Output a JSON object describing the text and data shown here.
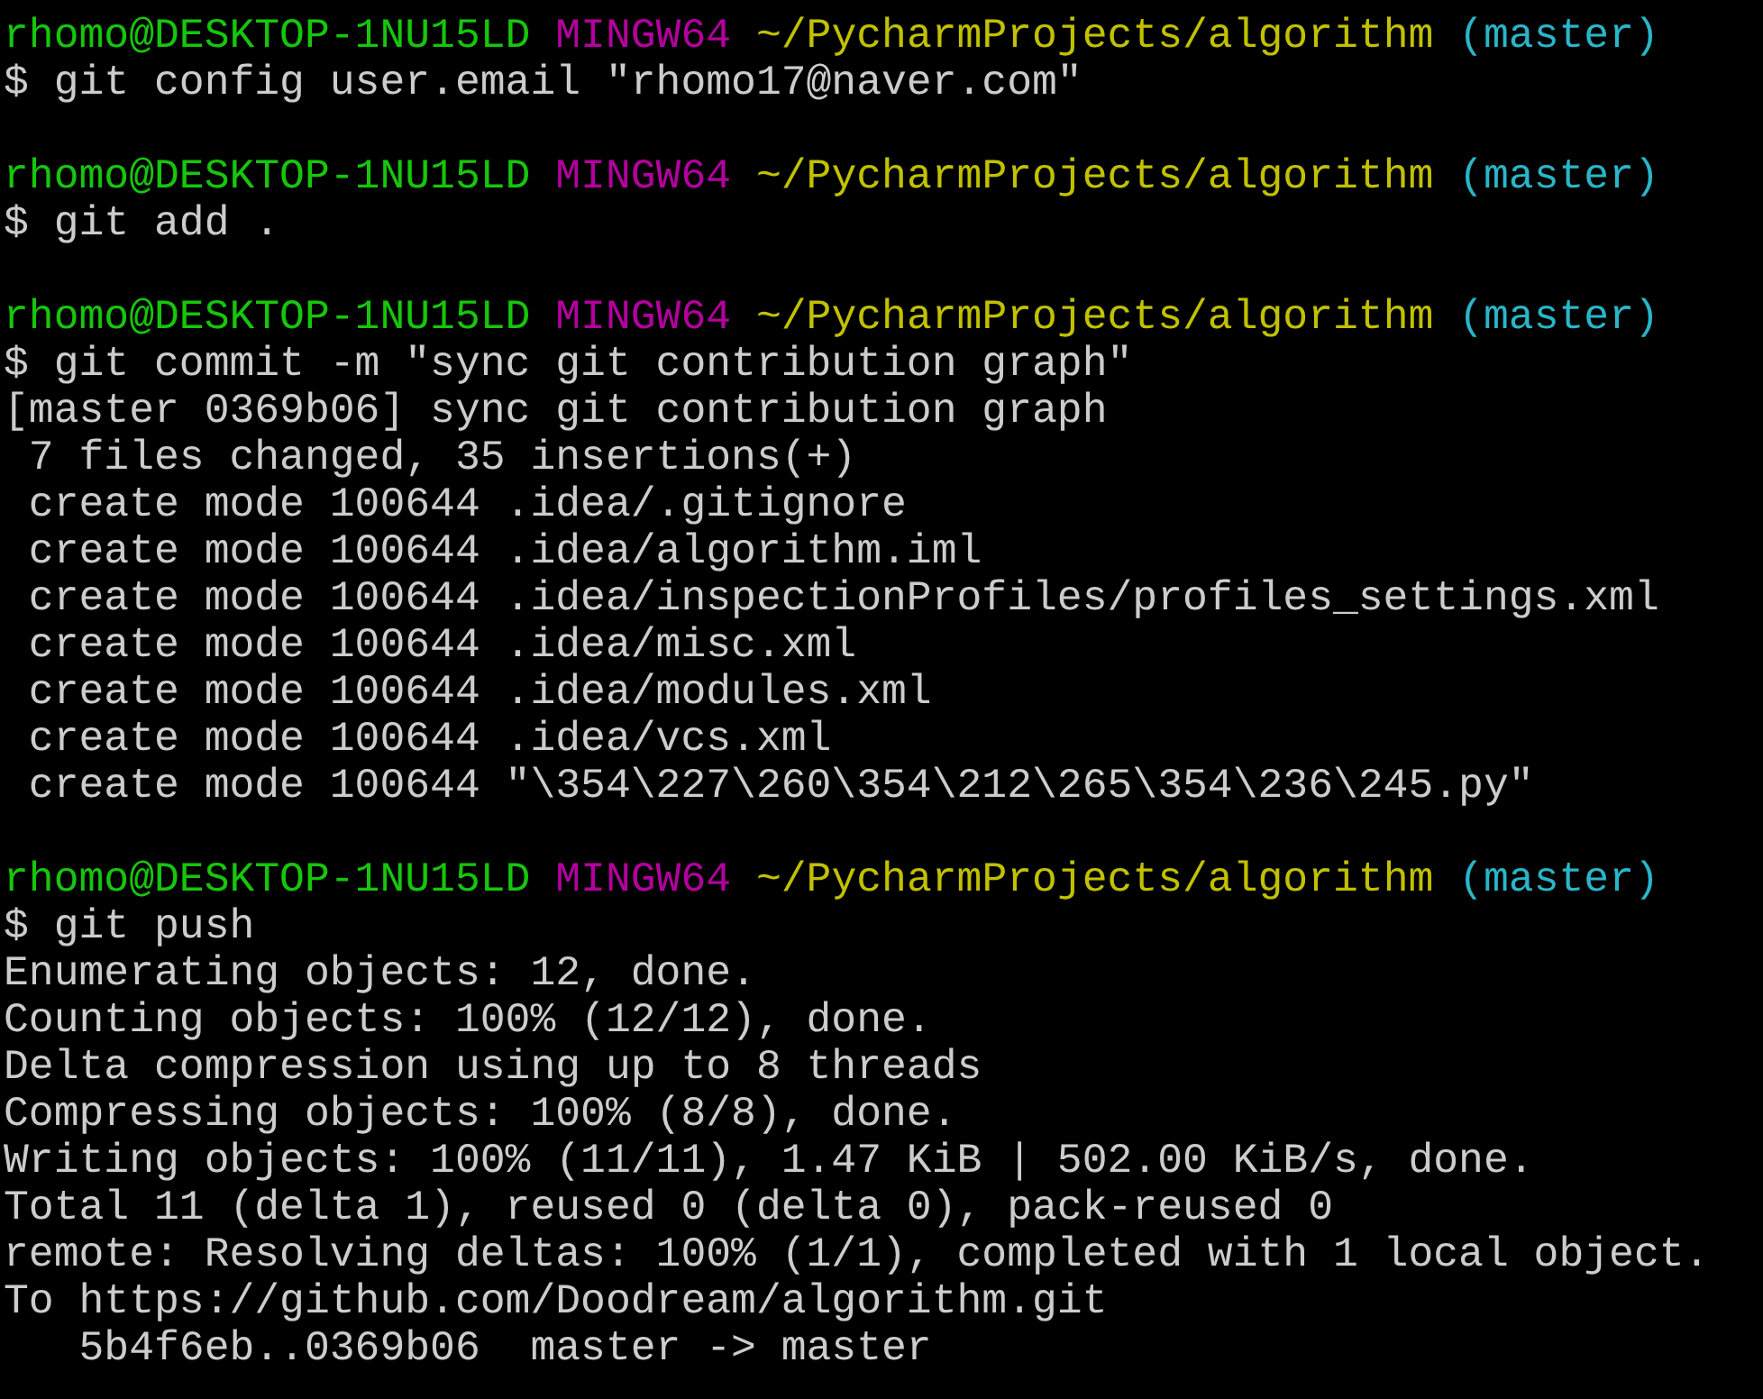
{
  "terminal": {
    "lines": [
      {
        "kind": "prompt",
        "user_host": "rhomo@DESKTOP-1NU15LD",
        "shell": "MINGW64",
        "path": "~/PycharmProjects/algorithm",
        "branch": "(master)"
      },
      {
        "kind": "command",
        "text": "$ git config user.email \"rhomo17@naver.com\""
      },
      {
        "kind": "blank"
      },
      {
        "kind": "prompt",
        "user_host": "rhomo@DESKTOP-1NU15LD",
        "shell": "MINGW64",
        "path": "~/PycharmProjects/algorithm",
        "branch": "(master)"
      },
      {
        "kind": "command",
        "text": "$ git add ."
      },
      {
        "kind": "blank"
      },
      {
        "kind": "prompt",
        "user_host": "rhomo@DESKTOP-1NU15LD",
        "shell": "MINGW64",
        "path": "~/PycharmProjects/algorithm",
        "branch": "(master)"
      },
      {
        "kind": "command",
        "text": "$ git commit -m \"sync git contribution graph\""
      },
      {
        "kind": "output",
        "text": "[master 0369b06] sync git contribution graph"
      },
      {
        "kind": "output",
        "text": " 7 files changed, 35 insertions(+)"
      },
      {
        "kind": "output",
        "text": " create mode 100644 .idea/.gitignore"
      },
      {
        "kind": "output",
        "text": " create mode 100644 .idea/algorithm.iml"
      },
      {
        "kind": "output",
        "text": " create mode 100644 .idea/inspectionProfiles/profiles_settings.xml"
      },
      {
        "kind": "output",
        "text": " create mode 100644 .idea/misc.xml"
      },
      {
        "kind": "output",
        "text": " create mode 100644 .idea/modules.xml"
      },
      {
        "kind": "output",
        "text": " create mode 100644 .idea/vcs.xml"
      },
      {
        "kind": "output",
        "text": " create mode 100644 \"\\354\\227\\260\\354\\212\\265\\354\\236\\245.py\""
      },
      {
        "kind": "blank"
      },
      {
        "kind": "prompt",
        "user_host": "rhomo@DESKTOP-1NU15LD",
        "shell": "MINGW64",
        "path": "~/PycharmProjects/algorithm",
        "branch": "(master)"
      },
      {
        "kind": "command",
        "text": "$ git push"
      },
      {
        "kind": "output",
        "text": "Enumerating objects: 12, done."
      },
      {
        "kind": "output",
        "text": "Counting objects: 100% (12/12), done."
      },
      {
        "kind": "output",
        "text": "Delta compression using up to 8 threads"
      },
      {
        "kind": "output",
        "text": "Compressing objects: 100% (8/8), done."
      },
      {
        "kind": "output",
        "text": "Writing objects: 100% (11/11), 1.47 KiB | 502.00 KiB/s, done."
      },
      {
        "kind": "output",
        "text": "Total 11 (delta 1), reused 0 (delta 0), pack-reused 0"
      },
      {
        "kind": "output",
        "text": "remote: Resolving deltas: 100% (1/1), completed with 1 local object."
      },
      {
        "kind": "output",
        "text": "To https://github.com/Doodream/algorithm.git"
      },
      {
        "kind": "output",
        "text": "   5b4f6eb..0369b06  master -> master"
      }
    ]
  }
}
